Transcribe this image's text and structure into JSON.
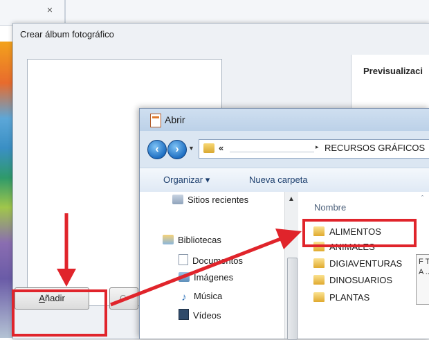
{
  "background_window": {
    "close_glyph": "×"
  },
  "album_dialog": {
    "title": "Crear álbum fotográfico",
    "preview_label": "Previsualizaci",
    "add_button": {
      "accel": "A",
      "rest": "ñadir"
    },
    "partial_button_text": "C"
  },
  "open_dialog": {
    "title": "Abrir",
    "address": {
      "chevron": "«",
      "separator": "▸",
      "path": "RECURSOS GRÁFICOS"
    },
    "toolbar": {
      "organize": "Organizar ▾",
      "new_folder": "Nueva carpeta"
    },
    "nav_pane": {
      "recent": "Sitios recientes",
      "libraries": "Bibliotecas",
      "documents": "Documentos",
      "images": "Imágenes",
      "music": "Música",
      "videos": "Vídeos"
    },
    "file_list": {
      "column_name": "Nombre",
      "files": [
        "ALIMENTOS",
        "ANIMALES",
        "DIGIAVENTURAS",
        "DINOSUARIOS",
        "PLANTAS"
      ]
    },
    "tooltip_text": "F T A ..."
  },
  "icons": {
    "back": "arrow-left-icon",
    "forward": "arrow-right-icon",
    "folder": "folder-icon",
    "music": "music-note-icon",
    "video": "film-icon"
  },
  "colors": {
    "annotation_red": "#e0242b",
    "window_frame": "#dbe6f2",
    "link_blue": "#1d3f6e"
  }
}
